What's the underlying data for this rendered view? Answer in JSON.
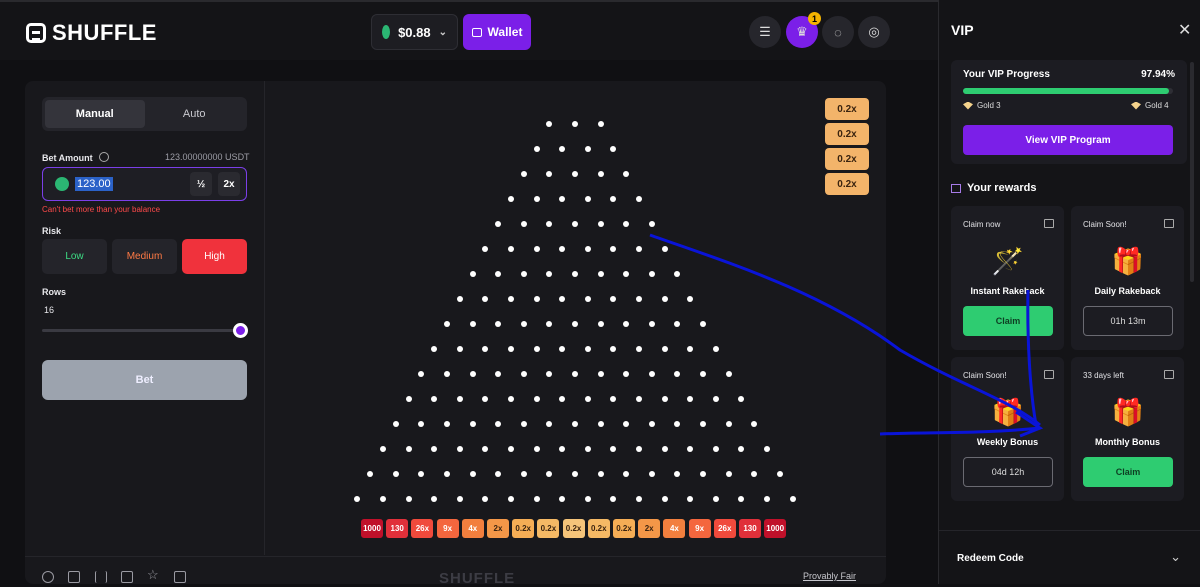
{
  "header": {
    "logo": "SHUFFLE",
    "balance": "$0.88",
    "wallet_label": "Wallet",
    "notif_count": "1",
    "icons": [
      "document-icon",
      "crown-icon",
      "chat-icon",
      "user-icon"
    ]
  },
  "controls": {
    "tabs": [
      "Manual",
      "Auto"
    ],
    "bet_label": "Bet Amount",
    "balance_display": "123.00000000 USDT",
    "bet_value": "123.00",
    "half": "½",
    "double": "2x",
    "error": "Can't bet more than your balance",
    "risk_label": "Risk",
    "risk": [
      "Low",
      "Medium",
      "High"
    ],
    "rows_label": "Rows",
    "rows_value": "16",
    "rows_level": 1.0,
    "bet_button": "Bet"
  },
  "board": {
    "rows": 16,
    "slots": [
      "1000",
      "130",
      "26x",
      "9x",
      "4x",
      "2x",
      "0.2x",
      "0.2x",
      "0.2x",
      "0.2x",
      "0.2x",
      "2x",
      "4x",
      "9x",
      "26x",
      "130",
      "1000"
    ],
    "history": [
      "0.2x",
      "0.2x",
      "0.2x",
      "0.2x"
    ]
  },
  "footer": {
    "brand": "SHUFFLE",
    "provably_fair": "Provably Fair"
  },
  "vip": {
    "title": "VIP",
    "progress_label": "Your VIP Progress",
    "progress_pct": "97.94%",
    "progress_value": 97.94,
    "current_tier": "Gold 3",
    "next_tier": "Gold 4",
    "program_button": "View VIP Program",
    "rewards_title": "Your rewards",
    "rewards": [
      {
        "status": "Claim now",
        "name": "Instant Rakeback",
        "action": "Claim",
        "style": "green"
      },
      {
        "status": "Claim Soon!",
        "name": "Daily Rakeback",
        "action": "01h 13m",
        "style": "out"
      },
      {
        "status": "Claim Soon!",
        "name": "Weekly Bonus",
        "action": "04d 12h",
        "style": "out"
      },
      {
        "status": "33 days left",
        "name": "Monthly Bonus",
        "action": "Claim",
        "style": "green"
      }
    ],
    "redeem": "Redeem Code"
  },
  "colors": {
    "accent": "#7b1fe8",
    "green": "#2ecc71",
    "annotation": "#0a14d8"
  }
}
